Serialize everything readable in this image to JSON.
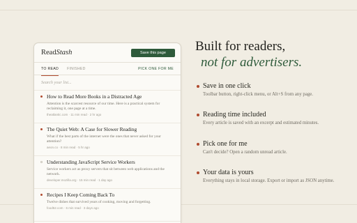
{
  "popup": {
    "logo_prefix": "Read",
    "logo_emphasis": "Stash",
    "save_label": "Save this page",
    "tabs": [
      {
        "label": "TO READ"
      },
      {
        "label": "FINISHED"
      }
    ],
    "pick_label": "PICK ONE FOR ME",
    "search_placeholder": "Search your list...",
    "articles": [
      {
        "title": "How to Read More Books in a Distracted Age",
        "excerpt": "Attention is the scarcest resource of our time. Here is a practical system for reclaiming it, one page at a time.",
        "meta": "theatlantic.com · 11 min read · 2 hr ago",
        "unread": true
      },
      {
        "title": "The Quiet Web: A Case for Slower Reading",
        "excerpt": "What if the best parts of the internet were the ones that never asked for your attention?",
        "meta": "aeon.co · 8 min read · 5 hr ago",
        "unread": true
      },
      {
        "title": "Understanding JavaScript Service Workers",
        "excerpt": "Service workers act as proxy servers that sit between web applications and the network.",
        "meta": "developer.mozilla.org · 15 min read · 1 day ago",
        "unread": false
      },
      {
        "title": "Recipes I Keep Coming Back To",
        "excerpt": "Twelve dishes that survived years of cooking, moving and forgetting.",
        "meta": "food52.com · 6 min read · 3 days ago",
        "unread": true
      }
    ]
  },
  "headline": {
    "line1": "Built for readers,",
    "line2": "not for advertisers."
  },
  "features": [
    {
      "title": "Save in one click",
      "desc": "Toolbar button, right-click menu, or Alt+S from any page."
    },
    {
      "title": "Reading time included",
      "desc": "Every article is saved with an excerpt and estimated minutes."
    },
    {
      "title": "Pick one for me",
      "desc": "Can't decide? Open a random unread article."
    },
    {
      "title": "Your data is yours",
      "desc": "Everything stays in local storage. Export or import as JSON anytime."
    }
  ],
  "colors": {
    "accent_green": "#2e5a3a",
    "accent_red": "#b04a2e",
    "background": "#f1ede3"
  }
}
